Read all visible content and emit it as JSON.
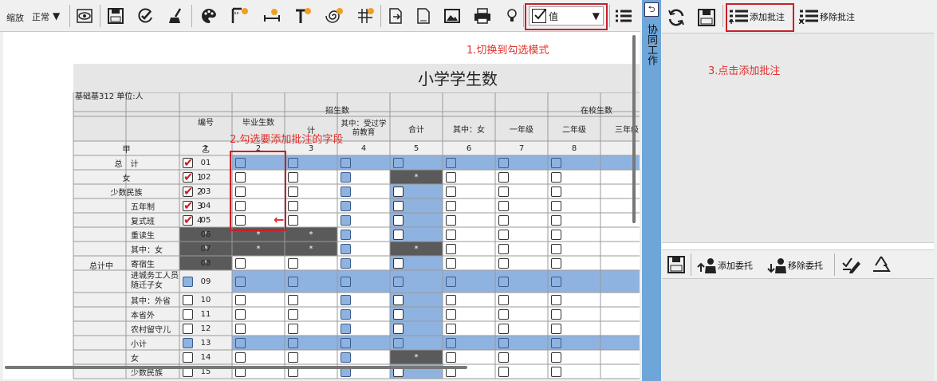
{
  "toolbar": {
    "zoom_label": "缩放",
    "zoom_value": "正常",
    "mode_value": "值"
  },
  "annotations": {
    "step1": "1.切换到勾选模式",
    "step2": "2.勾选要添加批注的字段",
    "step3": "3.点击添加批注"
  },
  "sheet": {
    "title": "小学学生数",
    "subtitle": "基础基312 单位:人",
    "header": {
      "bianhao": "编号",
      "biye": "毕业生数",
      "zhaosheng": "招生数",
      "ji": "计",
      "qizhong_shouguo": "其中：受过学前教育",
      "zaixiao": "在校生数",
      "heji": "合计",
      "qizhong_nv": "其中：女",
      "nianji1": "一年级",
      "nianji2": "二年级",
      "nianji3": "三年级"
    },
    "colnums": [
      "甲",
      "乙",
      "1",
      "2",
      "3",
      "4",
      "5",
      "6",
      "7",
      "8"
    ],
    "group_total": "总计中",
    "rows": [
      {
        "label": "总　计",
        "code": "01"
      },
      {
        "label": "女",
        "code": "02"
      },
      {
        "label": "少数民族",
        "code": "03"
      },
      {
        "label": "五年制",
        "code": "04"
      },
      {
        "label": "复式班",
        "code": "05"
      },
      {
        "label": "重读生",
        "code": "06"
      },
      {
        "label": "其中：女",
        "code": "07"
      },
      {
        "label": "寄宿生",
        "code": "08"
      },
      {
        "label": "进城务工人员随迁子女",
        "code": "09"
      },
      {
        "label": "其中：外省",
        "code": "10"
      },
      {
        "label": "本省外",
        "code": "11"
      },
      {
        "label": "农村留守儿",
        "code": "12"
      },
      {
        "label": "小计",
        "code": "13"
      },
      {
        "label": "女",
        "code": "14"
      },
      {
        "label": "少数民族",
        "code": "15"
      }
    ],
    "checked_values": [
      "",
      "1",
      "2",
      "3",
      "4"
    ],
    "star": "*",
    "arrow": "←"
  },
  "side_tab": {
    "label": "协同工作"
  },
  "panel": {
    "add_annotation": "添加批注",
    "remove_annotation": "移除批注",
    "add_delegate": "添加委托",
    "remove_delegate": "移除委托"
  }
}
